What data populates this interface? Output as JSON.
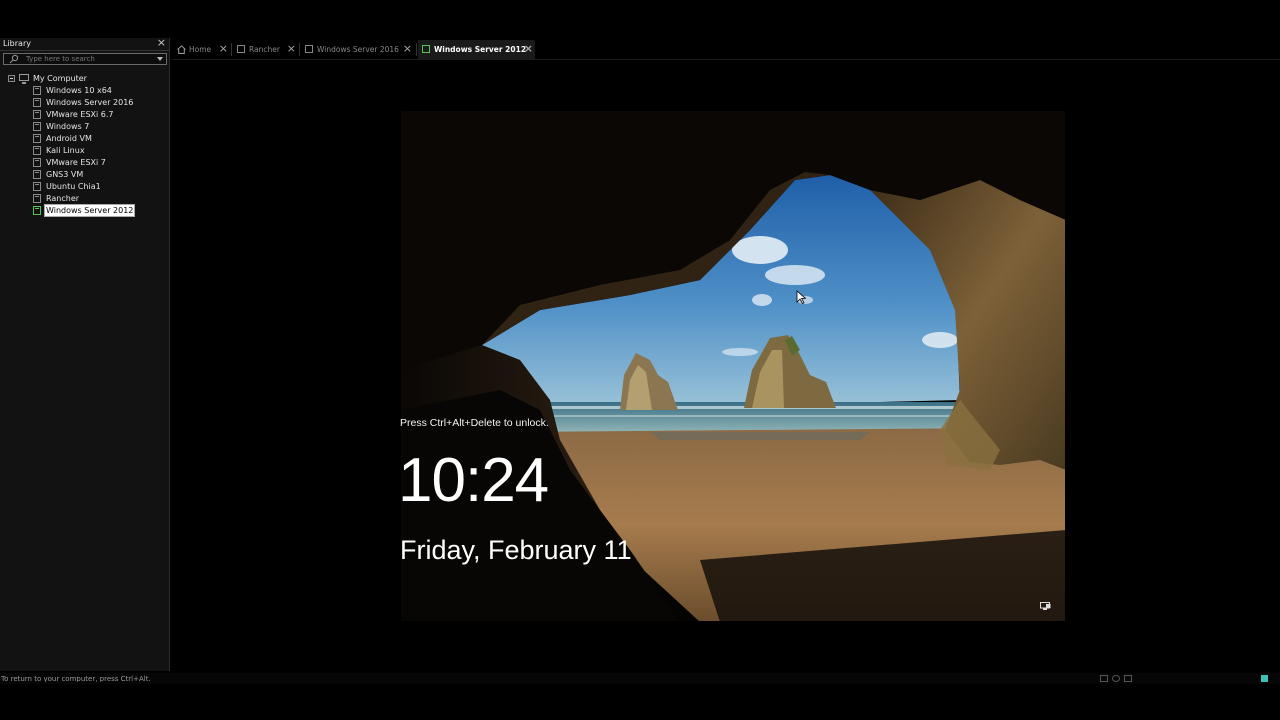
{
  "library": {
    "title": "Library",
    "close_label": "×",
    "search_placeholder": "Type here to search",
    "root_label": "My Computer",
    "vms": [
      {
        "label": "Windows 10 x64",
        "running": false,
        "selected": false
      },
      {
        "label": "Windows Server 2016",
        "running": false,
        "selected": false
      },
      {
        "label": "VMware ESXi 6.7",
        "running": false,
        "selected": false
      },
      {
        "label": "Windows 7",
        "running": false,
        "selected": false
      },
      {
        "label": "Android VM",
        "running": false,
        "selected": false
      },
      {
        "label": "Kali Linux",
        "running": false,
        "selected": false
      },
      {
        "label": "VMware ESXi 7",
        "running": false,
        "selected": false
      },
      {
        "label": "GNS3 VM",
        "running": false,
        "selected": false
      },
      {
        "label": "Ubuntu Chia1",
        "running": false,
        "selected": false
      },
      {
        "label": "Rancher",
        "running": false,
        "selected": false
      },
      {
        "label": "Windows Server 2012",
        "running": true,
        "selected": true
      }
    ]
  },
  "tabs": [
    {
      "label": "Home",
      "icon": "home-icon",
      "active": false
    },
    {
      "label": "Rancher",
      "icon": "vm-icon",
      "active": false
    },
    {
      "label": "Windows Server 2016",
      "icon": "vm-icon",
      "active": false
    },
    {
      "label": "Windows Server 2012",
      "icon": "vm-running-icon",
      "active": true
    }
  ],
  "tab_close_label": "×",
  "lockscreen": {
    "unlock_prompt": "Press Ctrl+Alt+Delete to unlock.",
    "time": "10:24",
    "date": "Friday, February 11",
    "network_icon": "network-icon"
  },
  "statusbar": {
    "text": "To return to your computer, press Ctrl+Alt."
  },
  "colors": {
    "running_vm": "#58c458",
    "status_indicator": "#3bbfb6",
    "background": "#000000"
  }
}
